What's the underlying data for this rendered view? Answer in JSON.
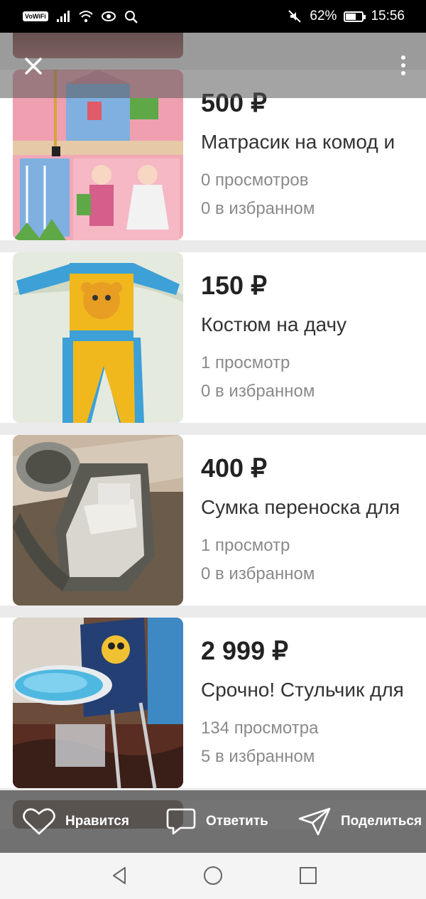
{
  "status_bar": {
    "carrier_badge": "VoWiFi",
    "battery": "62%",
    "time": "15:56",
    "battery_level": 0.62
  },
  "header": {
    "close_icon": "close-icon",
    "more_icon": "more-vertical-icon"
  },
  "listings": [
    {
      "price": "500 ₽",
      "title": "Матрасик на комод и",
      "views": "0 просмотров",
      "favorites": "0 в избранном",
      "image": "pink-wall-organizer-image"
    },
    {
      "price": "150 ₽",
      "title": "Костюм на дачу",
      "views": "1 просмотр",
      "favorites": "0 в избранном",
      "image": "kids-bear-suit-image"
    },
    {
      "price": "400 ₽",
      "title": "Сумка переноска для",
      "views": "1 просмотр",
      "favorites": "0 в избранном",
      "image": "baby-carrier-bag-image"
    },
    {
      "price": "2 999 ₽",
      "title": "Срочно! Стульчик для",
      "views": "134 просмотра",
      "favorites": "5 в избранном",
      "image": "high-chair-image"
    }
  ],
  "actions": {
    "like": "Нравится",
    "reply": "Ответить",
    "share": "Поделиться"
  },
  "colors": {
    "overlay": "#555555",
    "text_primary": "#222222",
    "text_secondary": "#8a8a8a"
  }
}
